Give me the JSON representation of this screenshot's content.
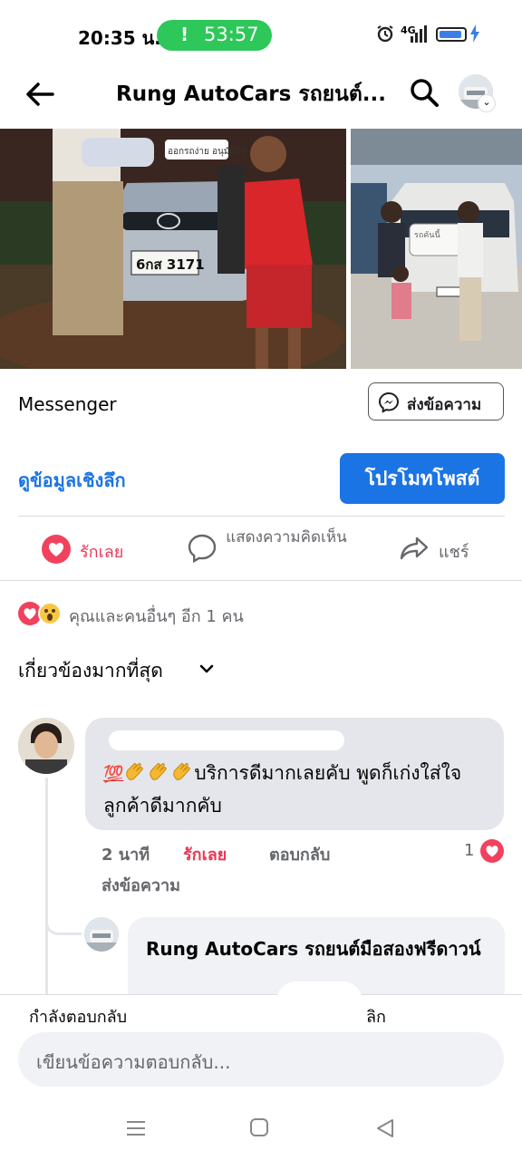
{
  "status_bar": {
    "time": "20:35 น.",
    "call_badge": "!",
    "call_duration": "53:57",
    "network": "4G"
  },
  "header": {
    "title": "Rung  AutoCars รถยนต์...",
    "icons": [
      "back-arrow-icon",
      "search-icon",
      "profile-avatar"
    ]
  },
  "photos": {
    "plate": "6กส 3171",
    "sign_left": "ออกรถง่าย อนุมัติไว",
    "sign_right": "รถคันนี้"
  },
  "messenger": {
    "label": "Messenger",
    "send_button": "ส่งข้อความ"
  },
  "insights": {
    "link": "ดูข้อมูลเชิงลึก",
    "promote_button": "โปรโมทโพสต์"
  },
  "actions": {
    "love": "รักเลย",
    "comment": "แสดงความคิดเห็น",
    "share": "แชร์"
  },
  "reactions": {
    "summary": "คุณและคนอื่นๆ อีก 1 คน"
  },
  "filter": {
    "label": "เกี่ยวข้องมากที่สุด"
  },
  "comment": {
    "emoji_100": "💯",
    "text": "บริการดีมากเลยคับ พูดก็เก่งใส่ใจลูกค้าดีมากคับ",
    "time": "2 นาที",
    "love": "รักเลย",
    "reply": "ตอบกลับ",
    "send_message": "ส่งข้อความ",
    "reaction_count": "1"
  },
  "reply_comment": {
    "name": "Rung  AutoCars รถยนต์มือสองฟรีดาวน์"
  },
  "reply_bar": {
    "replying_label": "กำลังตอบกลับ",
    "cancel": "ลิก",
    "placeholder": "เขียนข้อความตอบกลับ..."
  },
  "colors": {
    "accent": "#1b74e4",
    "love": "#e53a57",
    "call_green": "#2ec75a"
  }
}
